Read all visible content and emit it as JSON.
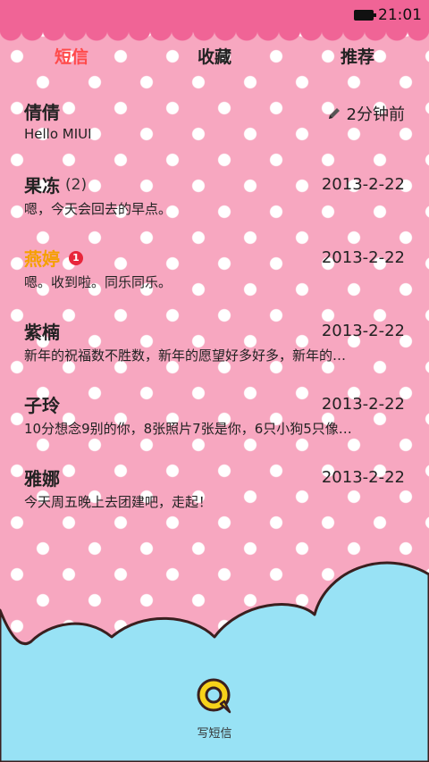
{
  "status": {
    "time": "21:01"
  },
  "tabs": [
    {
      "label": "短信",
      "active": true
    },
    {
      "label": "收藏",
      "active": false
    },
    {
      "label": "推荐",
      "active": false
    }
  ],
  "threads": [
    {
      "name": "倩倩",
      "count": "",
      "badge": "",
      "date": "2分钟前",
      "preview": "Hello MIUI",
      "unread": false,
      "draft": true
    },
    {
      "name": "果冻",
      "count": "(2)",
      "badge": "",
      "date": "2013-2-22",
      "preview": "嗯，今天会回去的早点。",
      "unread": false,
      "draft": false
    },
    {
      "name": "燕婷",
      "count": "",
      "badge": "1",
      "date": "2013-2-22",
      "preview": "嗯。收到啦。同乐同乐。",
      "unread": true,
      "draft": false
    },
    {
      "name": "紫楠",
      "count": "",
      "badge": "",
      "date": "2013-2-22",
      "preview": "新年的祝福数不胜数，新年的愿望好多好多，新年的…",
      "unread": false,
      "draft": false
    },
    {
      "name": "子玲",
      "count": "",
      "badge": "",
      "date": "2013-2-22",
      "preview": "10分想念9别的你，8张照片7张是你，6只小狗5只像…",
      "unread": false,
      "draft": false
    },
    {
      "name": "雅娜",
      "count": "",
      "badge": "",
      "date": "2013-2-22",
      "preview": "今天周五晚上去团建吧，走起！",
      "unread": false,
      "draft": false
    }
  ],
  "compose": {
    "label": "写短信",
    "icon": "compose-message-icon"
  },
  "colors": {
    "accent": "#ff4a4a",
    "unread": "#f5a000",
    "cloud": "#98e2f5",
    "header": "#f06496",
    "background": "#f7a7c0"
  }
}
